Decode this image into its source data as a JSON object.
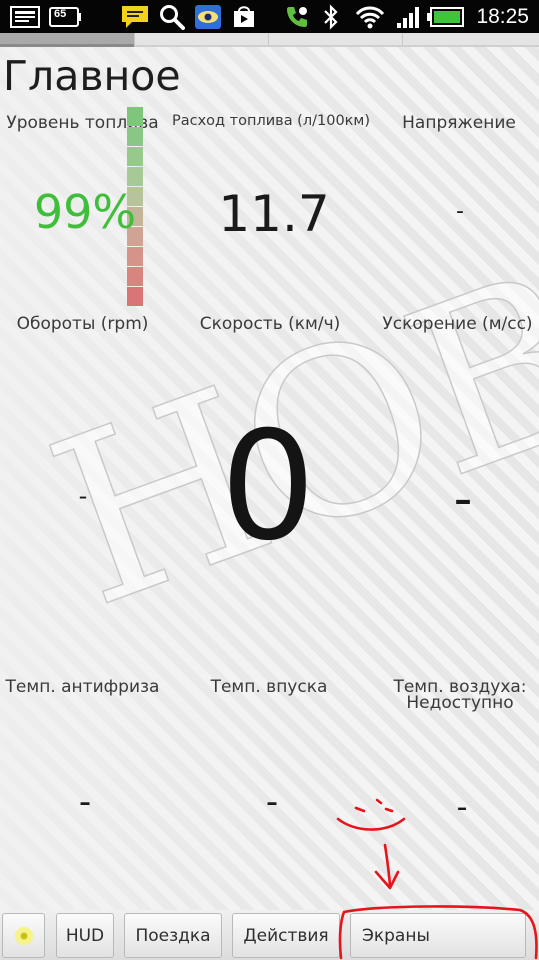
{
  "status_bar": {
    "time": "18:25",
    "notification_badge": "65",
    "icons": [
      "screen-icon",
      "battery-notification-icon",
      "message-icon",
      "search-icon",
      "eye-app-icon",
      "play-store-icon",
      "phone-icon",
      "bluetooth-icon",
      "wifi-icon",
      "signal-icon",
      "battery-icon"
    ]
  },
  "page": {
    "title": "Главное"
  },
  "gauges": {
    "fuel_level": {
      "label": "Уровень топлива",
      "value": "99%",
      "color": "#3fbe3a",
      "fill_fraction": 0.99
    },
    "fuel_consumption": {
      "label": "Расход топлива (л/100км)",
      "value": "11.7"
    },
    "voltage": {
      "label": "Напряжение",
      "value": "-"
    },
    "rpm": {
      "label": "Обороты (rpm)",
      "value": "-"
    },
    "speed": {
      "label": "Скорость (км/ч)",
      "value": "0"
    },
    "acceleration": {
      "label": "Ускорение (м/сс)",
      "value": "-"
    },
    "coolant_temp": {
      "label": "Темп. антифриза",
      "value": "-"
    },
    "intake_temp": {
      "label": "Темп. впуска",
      "value": "-"
    },
    "air_temp": {
      "label": "Темп. воздуха:",
      "sublabel": "Недоступно",
      "value": "-"
    }
  },
  "watermark_text": "НОВ",
  "bottom_nav": {
    "hud": "HUD",
    "trip": "Поездка",
    "actions": "Действия",
    "screens": "Экраны"
  },
  "colors": {
    "accent_green": "#3fbe3a",
    "annotation_red": "#e8141b",
    "fuel_bar_top": "#7cc47a",
    "fuel_bar_bottom": "#d76f73"
  }
}
